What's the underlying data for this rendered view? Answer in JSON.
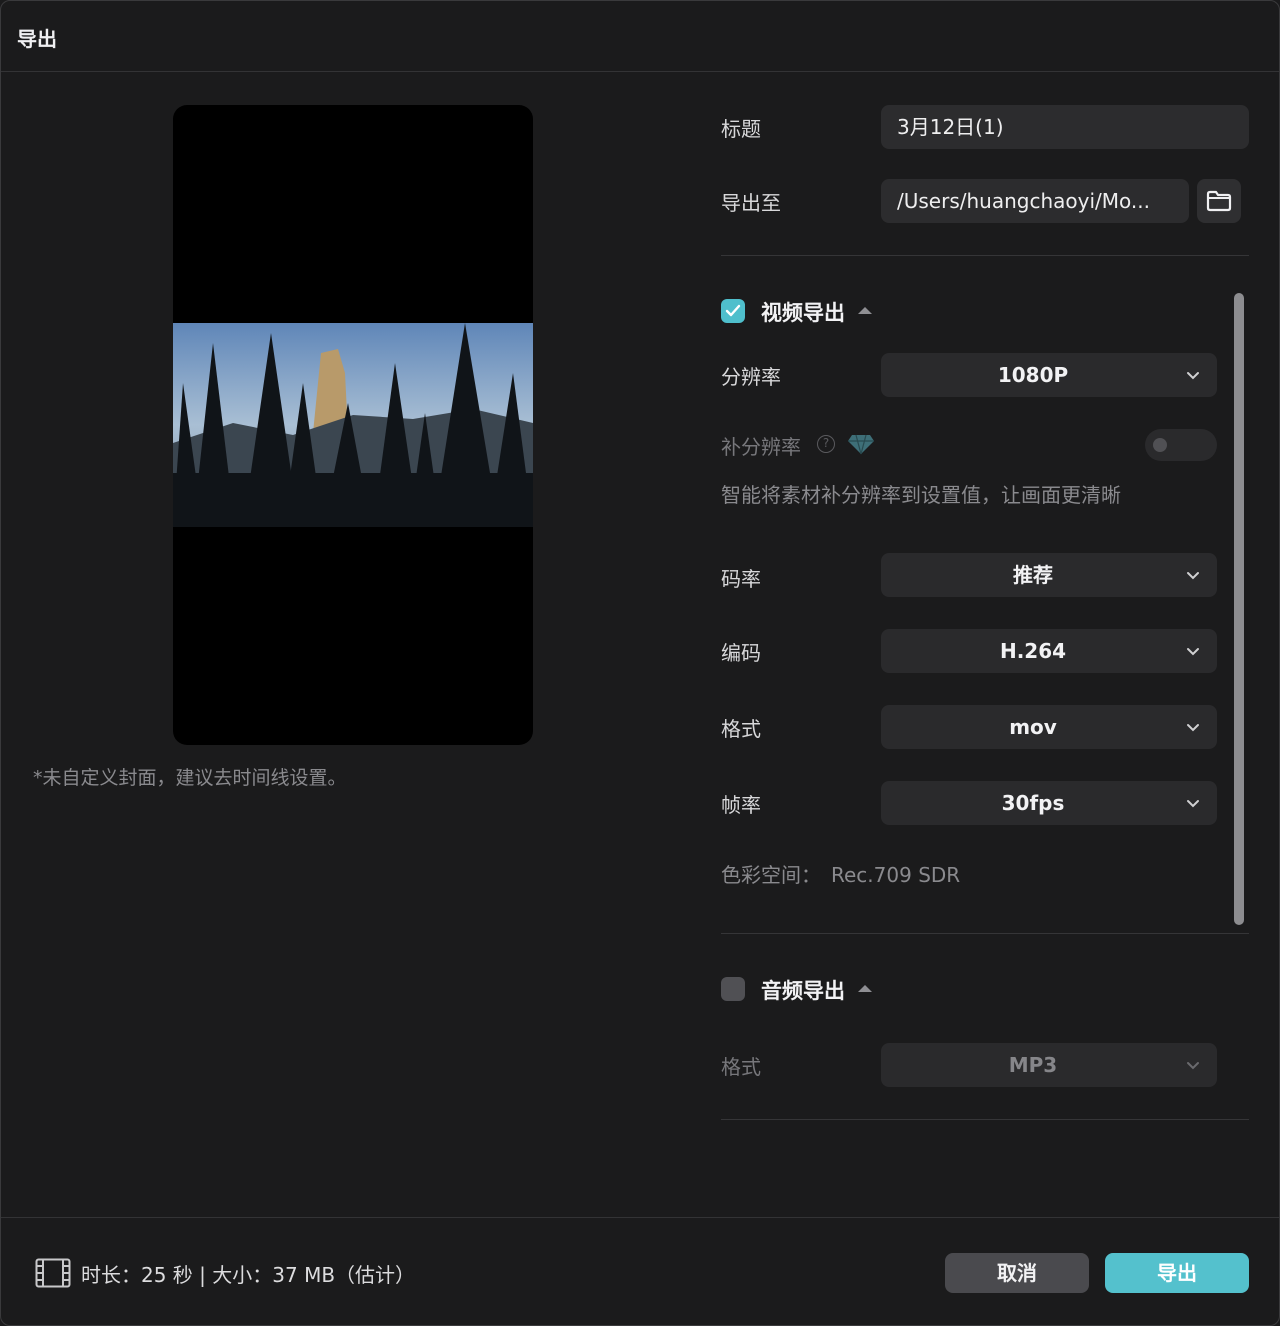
{
  "window": {
    "title": "导出"
  },
  "preview": {
    "cover_note": "*未自定义封面，建议去时间线设置。"
  },
  "form": {
    "title_label": "标题",
    "title_value": "3月12日(1)",
    "export_to_label": "导出至",
    "export_path": "/Users/huangchaoyi/Mo..."
  },
  "video": {
    "section_title": "视频导出",
    "enabled": true,
    "resolution_label": "分辨率",
    "resolution_value": "1080P",
    "super_res_label": "补分辨率",
    "super_res_desc": "智能将素材补分辨率到设置值，让画面更清晰",
    "bitrate_label": "码率",
    "bitrate_value": "推荐",
    "codec_label": "编码",
    "codec_value": "H.264",
    "format_label": "格式",
    "format_value": "mov",
    "framerate_label": "帧率",
    "framerate_value": "30fps",
    "colorspace_label": "色彩空间：",
    "colorspace_value": "Rec.709 SDR"
  },
  "audio": {
    "section_title": "音频导出",
    "enabled": false,
    "format_label": "格式",
    "format_value": "MP3"
  },
  "footer": {
    "info": "时长：25 秒 | 大小：37 MB（估计）",
    "cancel_label": "取消",
    "export_label": "导出"
  },
  "colors": {
    "accent": "#54c1cd",
    "background": "#1b1b1c",
    "field": "#2c2c2e"
  }
}
